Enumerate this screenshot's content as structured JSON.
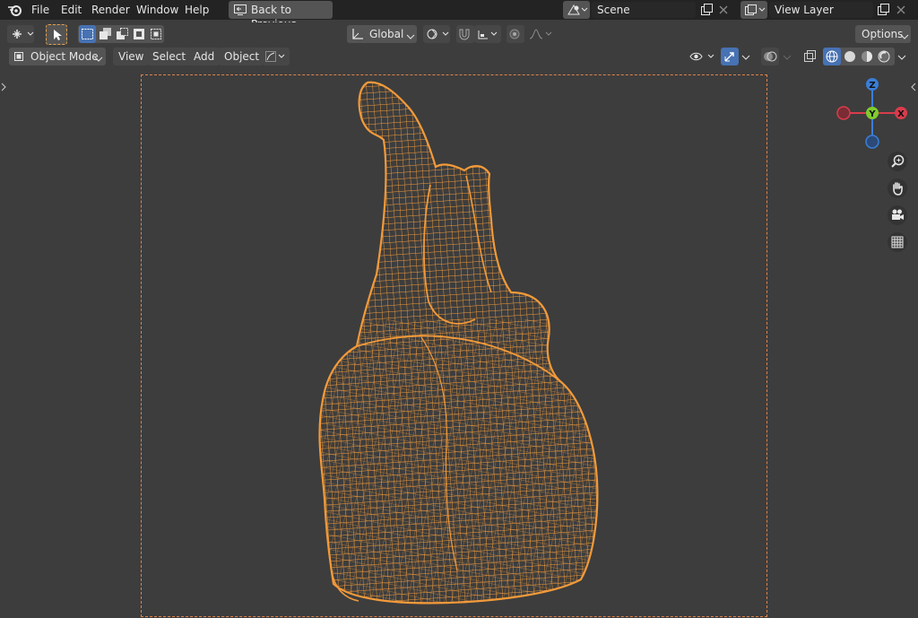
{
  "topbar": {
    "menu": [
      "File",
      "Edit",
      "Render",
      "Window",
      "Help"
    ],
    "back_button": "Back to Previous",
    "scene": {
      "name": "Scene"
    },
    "view_layer": {
      "name": "View Layer"
    }
  },
  "tool_header": {
    "transform_orientation": "Global",
    "options_label": "Options"
  },
  "viewport_header": {
    "mode": "Object Mode",
    "menus": [
      "View",
      "Select",
      "Add",
      "Object"
    ]
  },
  "gizmo": {
    "axes": {
      "z": "Z",
      "y": "Y",
      "x": "X"
    },
    "colors": {
      "x": "#d93c4c",
      "y": "#7ecc2f",
      "z": "#3a7ed9"
    }
  },
  "viewport": {
    "mesh_color": "#f29a3a",
    "camera_frame_color": "#e0844a"
  }
}
